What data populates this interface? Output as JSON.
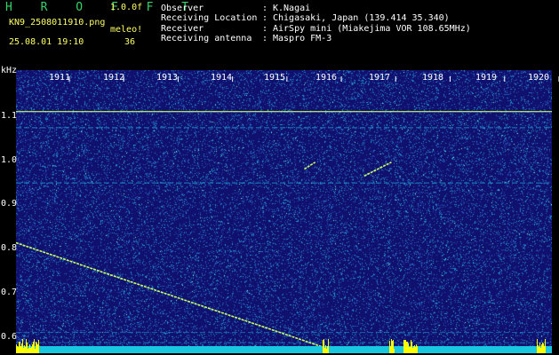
{
  "app": {
    "name": "H R O F F T",
    "version": "1.0.0f",
    "filename": "KN9_2508011910.png",
    "meleo_label": "meleo!",
    "timestamp": "25.08.01 19:10",
    "count": "36"
  },
  "meta": [
    {
      "label": "Observer",
      "value": "K.Nagai"
    },
    {
      "label": "Receiving Location",
      "value": "Chigasaki, Japan (139.414 35.340)"
    },
    {
      "label": "Receiver",
      "value": "AirSpy mini (Miakejima VOR 108.65MHz)"
    },
    {
      "label": "Receiving antenna",
      "value": "Maspro FM-3"
    }
  ],
  "colors": {
    "background": "#000000",
    "spectrum_bg": "#10106e",
    "noise_light": "#1d9bd1",
    "noise_hot": "#7fffe0",
    "trace": "#c8ff66",
    "baseline": "#18c8e0",
    "peaks": "#ffff00",
    "brand": "#34d36a"
  },
  "chart_data": {
    "type": "heatmap",
    "ylabel": "kHz",
    "y_ticks": [
      "1.1",
      "1.0",
      "0.9",
      "0.8",
      "0.7",
      "0.6"
    ],
    "x_ticks": [
      "1911",
      "1912",
      "1913",
      "1914",
      "1915",
      "1916",
      "1917",
      "1918",
      "1919",
      "1920"
    ],
    "ylim": [
      0.575,
      1.19
    ],
    "xlim": [
      1910.45,
      1920.3
    ],
    "traces": [
      {
        "kind": "carrier",
        "y": 1.1
      },
      {
        "kind": "carrier",
        "y": 1.065
      },
      {
        "kind": "carrier",
        "y": 0.945
      },
      {
        "kind": "carrier",
        "y": 0.62
      },
      {
        "kind": "carrier",
        "y": 0.598
      },
      {
        "kind": "meteor",
        "x": [
          1910.45,
          1916.3
        ],
        "y": [
          0.815,
          0.58
        ]
      },
      {
        "kind": "meteor",
        "x": [
          1915.75,
          1915.95
        ],
        "y": [
          0.975,
          0.99
        ]
      },
      {
        "kind": "meteor",
        "x": [
          1916.85,
          1917.35
        ],
        "y": [
          0.96,
          0.99
        ]
      }
    ]
  }
}
